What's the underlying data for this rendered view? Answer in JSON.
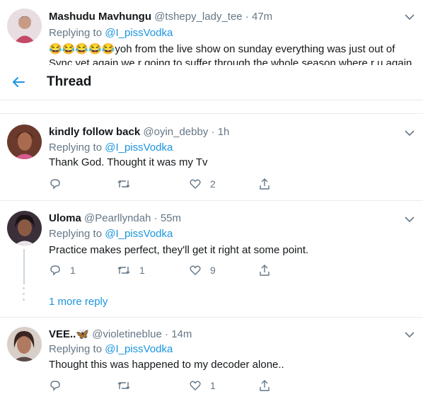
{
  "header": {
    "title": "Thread",
    "back_icon": "arrow-left-icon"
  },
  "colors": {
    "accent": "#1b95e0",
    "muted": "#657786",
    "border": "#e6ecf0"
  },
  "tweets": [
    {
      "name": "Mashudu Mavhungu",
      "handle": "@tshepy_lady_tee",
      "sep": "·",
      "time": "47m",
      "replying": "Replying to",
      "reply_to": "@I_pissVodka",
      "emoji": "😂😂😂😂😂",
      "text1": "yoh from the live show on sunday everything was just out of",
      "text2": "Sync yet again we r going to suffer through the whole season where r u again"
    },
    {
      "name": "kindly follow back",
      "handle": "@oyin_debby",
      "sep": "·",
      "time": "1h",
      "replying": "Replying to",
      "reply_to": "@I_pissVodka",
      "text": "Thank God. Thought it was my Tv",
      "replies": "",
      "retweets": "",
      "likes": "2"
    },
    {
      "name": "Uloma",
      "handle": "@Pearllyndah",
      "sep": "·",
      "time": "55m",
      "replying": "Replying to",
      "reply_to": "@I_pissVodka",
      "text": "Practice makes perfect, they'll get it right at some point.",
      "replies": "1",
      "retweets": "1",
      "likes": "9",
      "more_replies": "1 more reply"
    },
    {
      "name": "VEE..",
      "name_emoji": "🦋",
      "handle": "@violetineblue",
      "sep": "·",
      "time": "14m",
      "replying": "Replying to",
      "reply_to": "@I_pissVodka",
      "text": "Thought this was happened to my decoder alone..",
      "replies": "",
      "retweets": "",
      "likes": "1"
    }
  ]
}
